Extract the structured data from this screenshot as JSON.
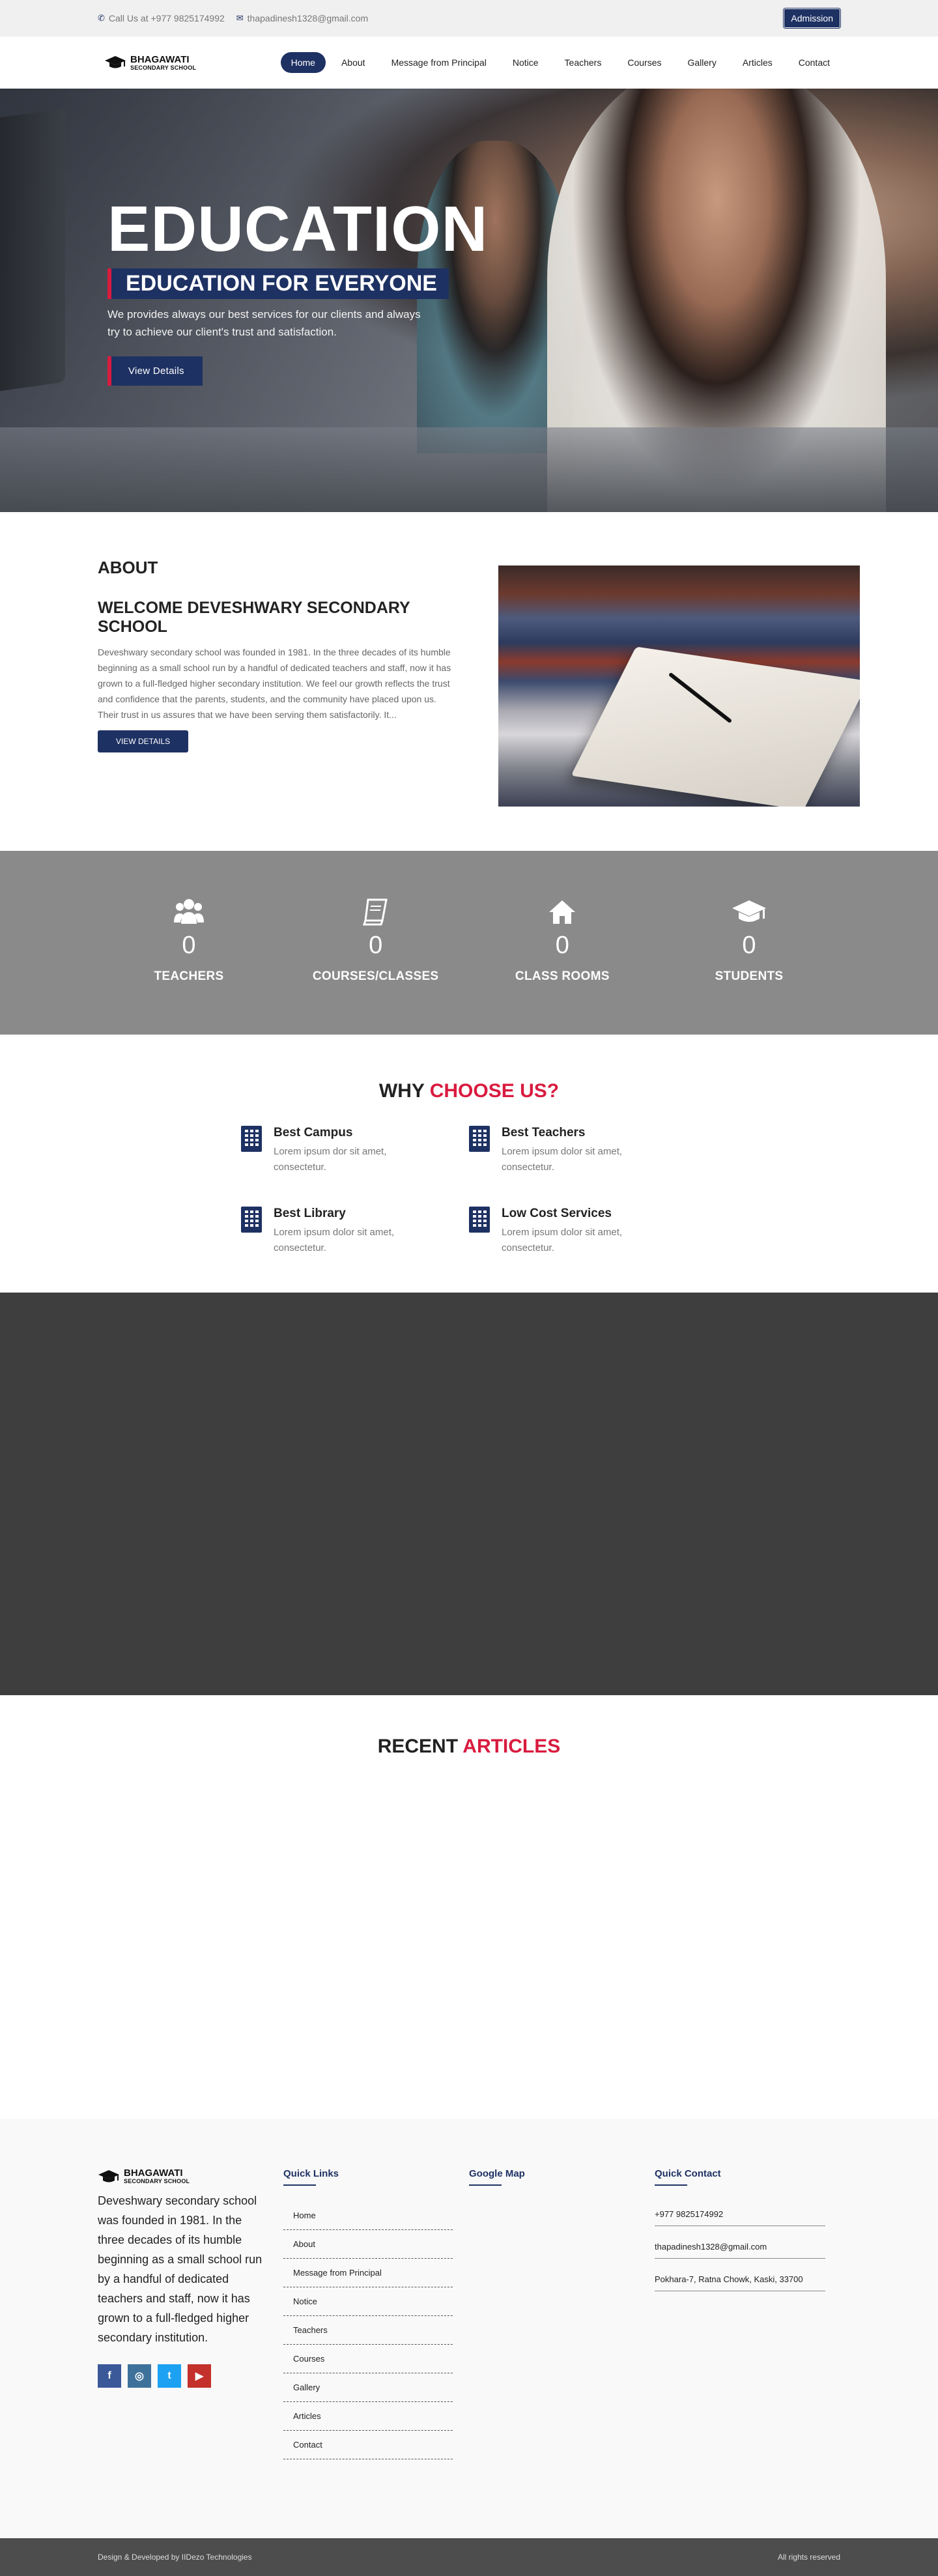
{
  "topbar": {
    "phone": "Call Us at +977 9825174992",
    "email": "thapadinesh1328@gmail.com",
    "admission": "Admission"
  },
  "logo": {
    "name": "BHAGAWATI",
    "sub": "SECONDARY SCHOOL"
  },
  "nav": [
    "Home",
    "About",
    "Message from Principal",
    "Notice",
    "Teachers",
    "Courses",
    "Gallery",
    "Articles",
    "Contact"
  ],
  "hero": {
    "title": "EDUCATION",
    "tagline": "EDUCATION FOR EVERYONE",
    "text": "We provides always our best services for our clients and always try to achieve our client's trust and satisfaction.",
    "button": "View Details"
  },
  "about": {
    "heading": "ABOUT",
    "title": "WELCOME DEVESHWARY SECONDARY SCHOOL",
    "text": "Deveshwary secondary school was founded in 1981. In the three decades of its humble beginning as a small school run by a handful of dedicated teachers and staff, now it has grown to a full-fledged higher secondary institution. We feel our growth reflects the trust and confidence that the parents, students, and the community have placed upon us. Their trust in us assures that we have been serving them satisfactorily. It...",
    "button": "VIEW DETAILS"
  },
  "stats": [
    {
      "icon": "users-icon",
      "value": "0",
      "label": "TEACHERS"
    },
    {
      "icon": "book-icon",
      "value": "0",
      "label": "COURSES/CLASSES"
    },
    {
      "icon": "home-icon",
      "value": "0",
      "label": "CLASS ROOMS"
    },
    {
      "icon": "graduation-cap-icon",
      "value": "0",
      "label": "STUDENTS"
    }
  ],
  "why": {
    "title_a": "WHY",
    "title_b": "CHOOSE US?",
    "items": [
      {
        "title": "Best Campus",
        "text": "Lorem ipsum dor sit amet, consectetur."
      },
      {
        "title": "Best Teachers",
        "text": "Lorem ipsum dolor sit amet, consectetur."
      },
      {
        "title": "Best Library",
        "text": "Lorem ipsum dolor sit amet, consectetur."
      },
      {
        "title": "Low Cost Services",
        "text": "Lorem ipsum dolor sit amet, consectetur."
      }
    ]
  },
  "articles": {
    "title_a": "RECENT",
    "title_b": "ARTICLES"
  },
  "footer": {
    "about": "Deveshwary secondary school was founded in 1981. In the three decades of its humble beginning as a small school run by a handful of dedicated teachers and staff, now it has grown to a full-fledged higher secondary institution.",
    "quick_links_title": "Quick Links",
    "quick_links": [
      "Home",
      "About",
      "Message from Principal",
      "Notice",
      "Teachers",
      "Courses",
      "Gallery",
      "Articles",
      "Contact"
    ],
    "map_title": "Google Map",
    "contact_title": "Quick Contact",
    "contact": [
      "+977 9825174992",
      "thapadinesh1328@gmail.com",
      "Pokhara-7, Ratna Chowk, Kaski, 33700"
    ],
    "social": [
      {
        "icon": "facebook-icon",
        "glyph": "f",
        "color": "#3b5998"
      },
      {
        "icon": "instagram-icon",
        "glyph": "◎",
        "color": "#3f729b"
      },
      {
        "icon": "twitter-icon",
        "glyph": "t",
        "color": "#1da1f2"
      },
      {
        "icon": "youtube-icon",
        "glyph": "▶",
        "color": "#c4302b"
      }
    ]
  },
  "bottom": {
    "left": "Design & Developed by IIDezo Technologies",
    "right": "All rights reserved"
  },
  "colors": {
    "primary": "#1e3163",
    "accent": "#d91b3f"
  }
}
